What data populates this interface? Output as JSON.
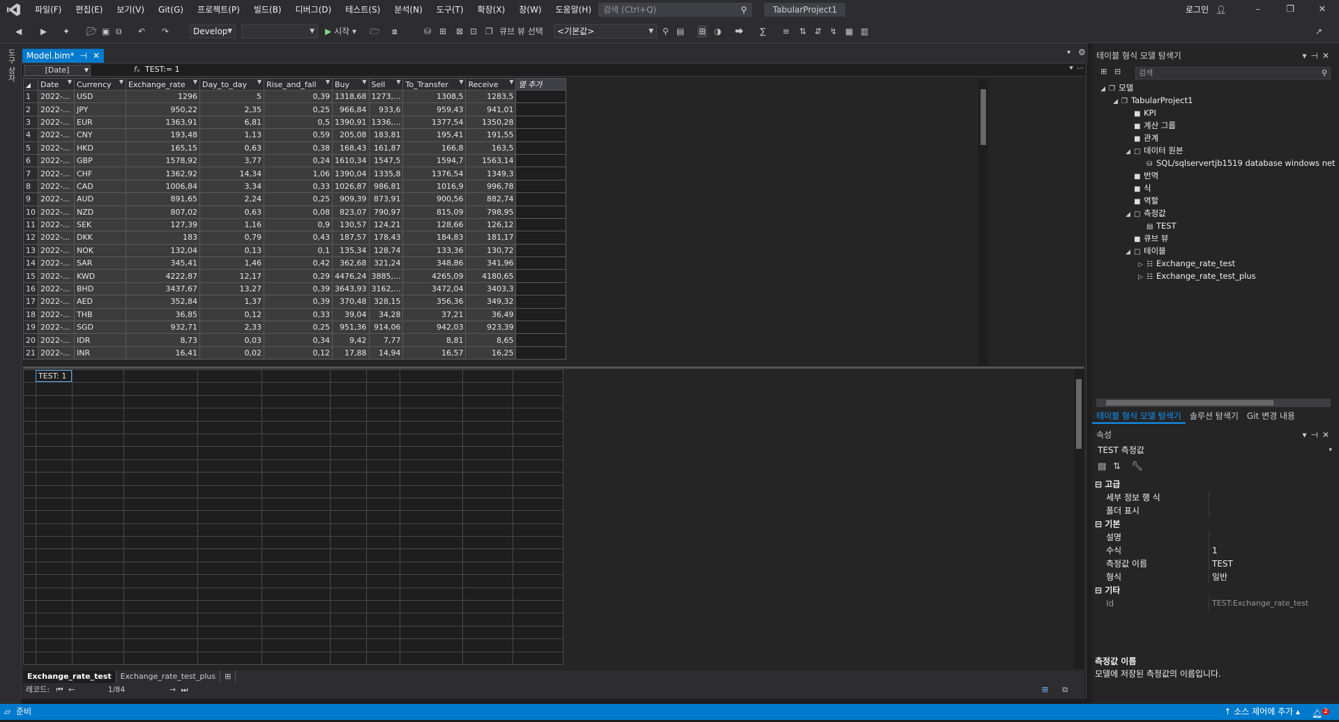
{
  "menubar": {
    "items": [
      "파일(F)",
      "편집(E)",
      "보기(V)",
      "Git(G)",
      "프로젝트(P)",
      "빌드(B)",
      "디버그(D)",
      "테스트(S)",
      "분석(N)",
      "도구(T)",
      "확장(X)",
      "창(W)",
      "도움말(H)"
    ],
    "search_placeholder": "검색 (Ctrl+Q)",
    "project_name": "TabularProject1",
    "login": "로그인"
  },
  "toolbar": {
    "config": "Develop",
    "start": "시작",
    "cube_view": "큐브 뷰 선택",
    "perspective": "<기본값>"
  },
  "left_strip": {
    "label": "도구 상자"
  },
  "document": {
    "tab_title": "Model.bim*",
    "column_selector": "[Date]",
    "formula": "TEST:= 1",
    "columns": [
      "Date",
      "Currency",
      "Exchange_rate",
      "Day_to_day",
      "Rise_and_fall",
      "Buy",
      "Sell",
      "To_Transfer",
      "Receive"
    ],
    "add_column": "열 추가",
    "rows": [
      [
        "1",
        "2022-...",
        "USD",
        "1296",
        "5",
        "0,39",
        "1318,68",
        "1273,...",
        "1308,5",
        "1283,5"
      ],
      [
        "2",
        "2022-...",
        "JPY",
        "950,22",
        "2,35",
        "0,25",
        "966,84",
        "933,6",
        "959,43",
        "941,01"
      ],
      [
        "3",
        "2022-...",
        "EUR",
        "1363,91",
        "6,81",
        "0,5",
        "1390,91",
        "1336,...",
        "1377,54",
        "1350,28"
      ],
      [
        "4",
        "2022-...",
        "CNY",
        "193,48",
        "1,13",
        "0,59",
        "205,08",
        "183,81",
        "195,41",
        "191,55"
      ],
      [
        "5",
        "2022-...",
        "HKD",
        "165,15",
        "0,63",
        "0,38",
        "168,43",
        "161,87",
        "166,8",
        "163,5"
      ],
      [
        "6",
        "2022-...",
        "GBP",
        "1578,92",
        "3,77",
        "0,24",
        "1610,34",
        "1547,5",
        "1594,7",
        "1563,14"
      ],
      [
        "7",
        "2022-...",
        "CHF",
        "1362,92",
        "14,34",
        "1,06",
        "1390,04",
        "1335,8",
        "1376,54",
        "1349,3"
      ],
      [
        "8",
        "2022-...",
        "CAD",
        "1006,84",
        "3,34",
        "0,33",
        "1026,87",
        "986,81",
        "1016,9",
        "996,78"
      ],
      [
        "9",
        "2022-...",
        "AUD",
        "891,65",
        "2,24",
        "0,25",
        "909,39",
        "873,91",
        "900,56",
        "882,74"
      ],
      [
        "10",
        "2022-...",
        "NZD",
        "807,02",
        "0,63",
        "0,08",
        "823,07",
        "790,97",
        "815,09",
        "798,95"
      ],
      [
        "11",
        "2022-...",
        "SEK",
        "127,39",
        "1,16",
        "0,9",
        "130,57",
        "124,21",
        "128,66",
        "126,12"
      ],
      [
        "12",
        "2022-...",
        "DKK",
        "183",
        "0,79",
        "0,43",
        "187,57",
        "178,43",
        "184,83",
        "181,17"
      ],
      [
        "13",
        "2022-...",
        "NOK",
        "132,04",
        "0,13",
        "0,1",
        "135,34",
        "128,74",
        "133,36",
        "130,72"
      ],
      [
        "14",
        "2022-...",
        "SAR",
        "345,41",
        "1,46",
        "0,42",
        "362,68",
        "321,24",
        "348,86",
        "341,96"
      ],
      [
        "15",
        "2022-...",
        "KWD",
        "4222,87",
        "12,17",
        "0,29",
        "4476,24",
        "3885,...",
        "4265,09",
        "4180,65"
      ],
      [
        "16",
        "2022-...",
        "BHD",
        "3437,67",
        "13,27",
        "0,39",
        "3643,93",
        "3162,...",
        "3472,04",
        "3403,3"
      ],
      [
        "17",
        "2022-...",
        "AED",
        "352,84",
        "1,37",
        "0,39",
        "370,48",
        "328,15",
        "356,36",
        "349,32"
      ],
      [
        "18",
        "2022-...",
        "THB",
        "36,85",
        "0,12",
        "0,33",
        "39,04",
        "34,28",
        "37,21",
        "36,49"
      ],
      [
        "19",
        "2022-...",
        "SGD",
        "932,71",
        "2,33",
        "0,25",
        "951,36",
        "914,06",
        "942,03",
        "923,39"
      ],
      [
        "20",
        "2022-...",
        "IDR",
        "8,73",
        "0,03",
        "0,34",
        "9,42",
        "7,77",
        "8,81",
        "8,65"
      ],
      [
        "21",
        "2022-...",
        "INR",
        "16,41",
        "0,02",
        "0,12",
        "17,88",
        "14,94",
        "16,57",
        "16,25"
      ]
    ],
    "measure_cell": "TEST: 1",
    "sheets": [
      "Exchange_rate_test",
      "Exchange_rate_test_plus"
    ],
    "record_label": "레코드:",
    "record_pos": "1/84"
  },
  "tabular_explorer": {
    "title": "테이블 형식 모델 탐색기",
    "search_placeholder": "검색",
    "tree": {
      "model": "모델",
      "project": "TabularProject1",
      "kpi": "KPI",
      "calc_groups": "계산 그룹",
      "relationships": "관계",
      "data_sources": "데이터 원본",
      "data_source_item": "SQL/sqlservertjb1519 database windows net",
      "translations": "번역",
      "expressions": "식",
      "roles": "역할",
      "measures": "측정값",
      "measure_item": "TEST",
      "perspectives": "큐브 뷰",
      "tables": "테이블",
      "table1": "Exchange_rate_test",
      "table2": "Exchange_rate_test_plus"
    }
  },
  "panel_tabs": [
    "테이블 형식 모델 탐색기",
    "솔루션 탐색기",
    "Git 변경 내용"
  ],
  "properties": {
    "title": "속성",
    "selected": "TEST 측정값",
    "cat_advanced": "고급",
    "detail_rows": "세부 정보 행 식",
    "display_folder": "폴더 표시",
    "cat_basic": "기본",
    "description": "설명",
    "formula_name": "수식",
    "formula_value": "1",
    "measure_name": "측정값 이름",
    "measure_name_value": "TEST",
    "format_name": "형식",
    "format_value": "일반",
    "cat_misc": "기타",
    "id_name": "Id",
    "id_value": "TEST:Exchange_rate_test",
    "desc_title": "측정값 이름",
    "desc_text": "모델에 저장된 측정값의 이름입니다."
  },
  "statusbar": {
    "ready": "준비",
    "source_control": "소스 제어에 추가",
    "notif_count": "2"
  }
}
